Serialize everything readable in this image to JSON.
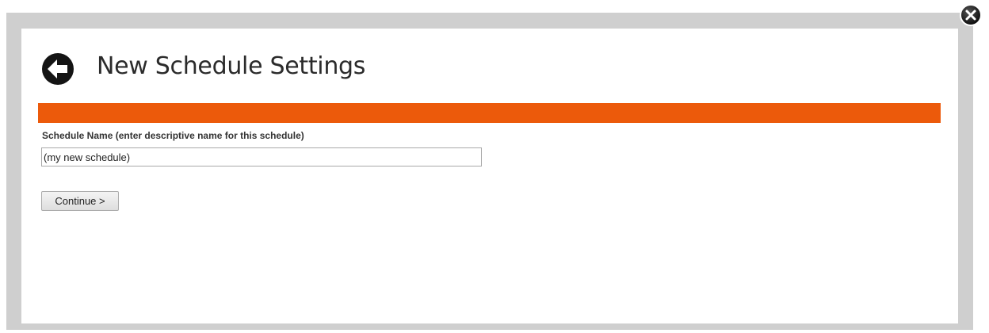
{
  "header": {
    "title": "New Schedule Settings",
    "back_icon": "arrow-left-circle-icon"
  },
  "modal": {
    "close_icon": "close-circle-icon",
    "accent_color": "#ec5a0b"
  },
  "form": {
    "schedule_name_label": "Schedule Name (enter descriptive name for this schedule)",
    "schedule_name_value": "(my new schedule)",
    "continue_label": "Continue >"
  }
}
